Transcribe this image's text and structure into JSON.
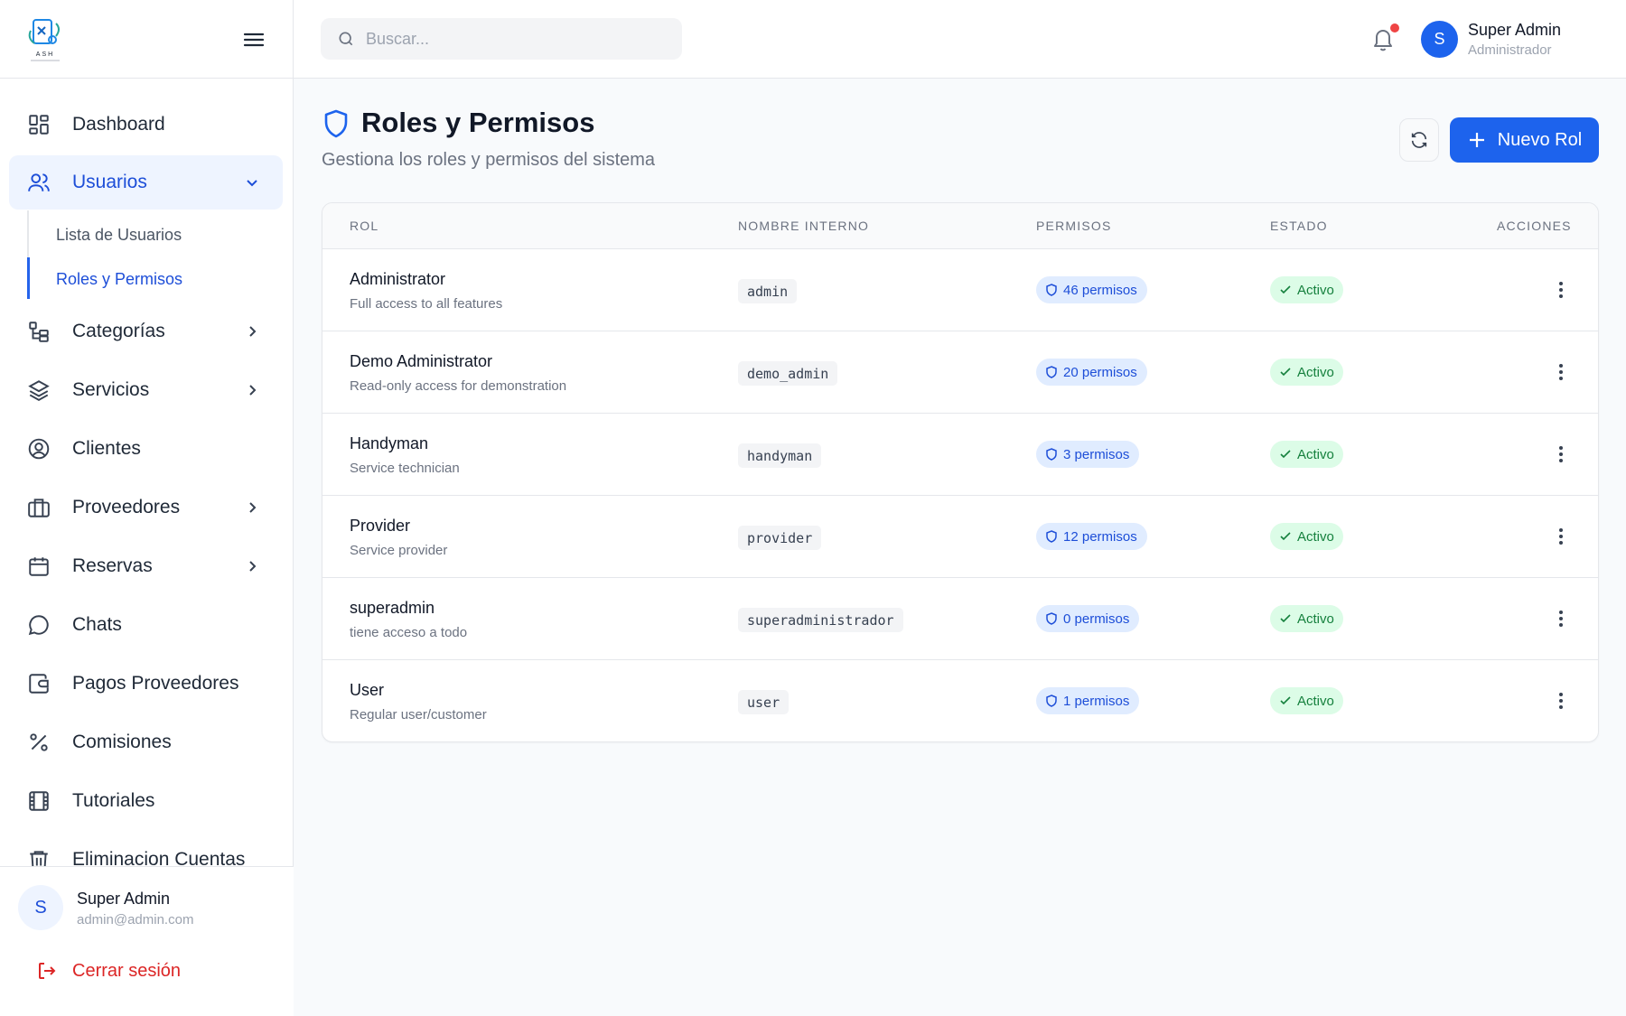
{
  "brand": {
    "logo_text": "ASH"
  },
  "sidebar": {
    "items": [
      {
        "label": "Dashboard",
        "icon": "dashboard-icon"
      },
      {
        "label": "Usuarios",
        "icon": "users-icon",
        "expanded": true,
        "active": true
      },
      {
        "label": "Categorías",
        "icon": "categories-icon",
        "has_submenu": true
      },
      {
        "label": "Servicios",
        "icon": "layers-icon",
        "has_submenu": true
      },
      {
        "label": "Clientes",
        "icon": "user-circle-icon"
      },
      {
        "label": "Proveedores",
        "icon": "briefcase-icon",
        "has_submenu": true
      },
      {
        "label": "Reservas",
        "icon": "calendar-icon",
        "has_submenu": true
      },
      {
        "label": "Chats",
        "icon": "chat-icon"
      },
      {
        "label": "Pagos Proveedores",
        "icon": "wallet-icon"
      },
      {
        "label": "Comisiones",
        "icon": "percent-icon"
      },
      {
        "label": "Tutoriales",
        "icon": "film-icon"
      },
      {
        "label": "Eliminacion Cuentas",
        "icon": "trash-icon"
      }
    ],
    "sub_items": [
      {
        "label": "Lista de Usuarios"
      },
      {
        "label": "Roles y Permisos",
        "active": true
      }
    ],
    "footer": {
      "name": "Super Admin",
      "email": "admin@admin.com",
      "avatar_letter": "S",
      "logout_label": "Cerrar sesión"
    }
  },
  "topbar": {
    "search_placeholder": "Buscar...",
    "notification_dot": true,
    "user": {
      "name": "Super Admin",
      "role": "Administrador",
      "avatar_letter": "S"
    }
  },
  "page": {
    "title": "Roles y Permisos",
    "subtitle": "Gestiona los roles y permisos del sistema",
    "new_button_label": "Nuevo Rol"
  },
  "table": {
    "headers": {
      "rol": "ROL",
      "internal": "NOMBRE INTERNO",
      "perms": "PERMISOS",
      "state": "ESTADO",
      "actions": "ACCIONES"
    },
    "rows": [
      {
        "name": "Administrator",
        "description": "Full access to all features",
        "internal": "admin",
        "permissions": "46 permisos",
        "state": "Activo"
      },
      {
        "name": "Demo Administrator",
        "description": "Read-only access for demonstration",
        "internal": "demo_admin",
        "permissions": "20 permisos",
        "state": "Activo"
      },
      {
        "name": "Handyman",
        "description": "Service technician",
        "internal": "handyman",
        "permissions": "3 permisos",
        "state": "Activo"
      },
      {
        "name": "Provider",
        "description": "Service provider",
        "internal": "provider",
        "permissions": "12 permisos",
        "state": "Activo"
      },
      {
        "name": "superadmin",
        "description": "tiene acceso a todo",
        "internal": "superadministrador",
        "permissions": "0 permisos",
        "state": "Activo"
      },
      {
        "name": "User",
        "description": "Regular user/customer",
        "internal": "user",
        "permissions": "1 permisos",
        "state": "Activo"
      }
    ]
  },
  "colors": {
    "primary": "#1d63ed",
    "active_bg": "#eef4ff",
    "success_bg": "#dcfce7",
    "success_text": "#15803d",
    "danger": "#dc2626"
  }
}
